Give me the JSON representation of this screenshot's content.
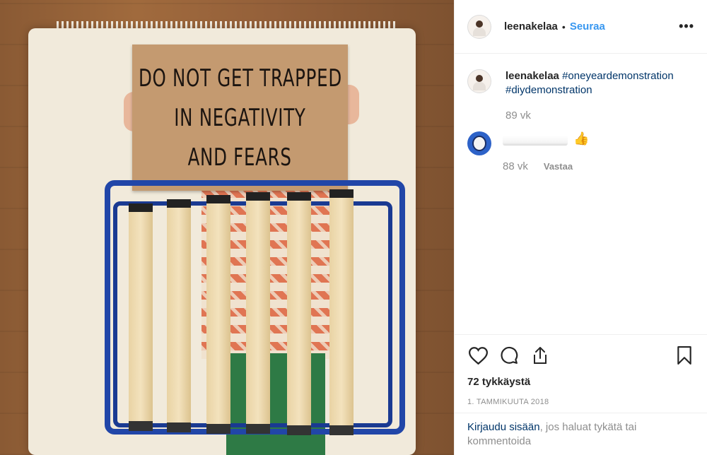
{
  "post": {
    "sign_lines": [
      "DO NOT GET TRAPPED",
      "IN NEGATIVITY",
      "AND FEARS"
    ]
  },
  "header": {
    "username": "leenakelaa",
    "separator": "•",
    "follow_label": "Seuraa",
    "more_icon": "more-horizontal-icon",
    "more_glyph": "•••"
  },
  "caption": {
    "username": "leenakelaa",
    "hashtags": [
      "#oneyeardemonstration",
      "#diydemonstration"
    ],
    "age": "89 vk"
  },
  "comment": {
    "emoji": "👍",
    "age": "88 vk",
    "reply_label": "Vastaa"
  },
  "actions": {
    "icons": [
      "heart-icon",
      "comment-icon",
      "share-icon",
      "bookmark-icon"
    ],
    "likes": "72 tykkäystä",
    "date": "1. TAMMIKUUTA 2018"
  },
  "login": {
    "link": "Kirjaudu sisään",
    "rest": ", jos haluat tykätä tai kommentoida"
  }
}
